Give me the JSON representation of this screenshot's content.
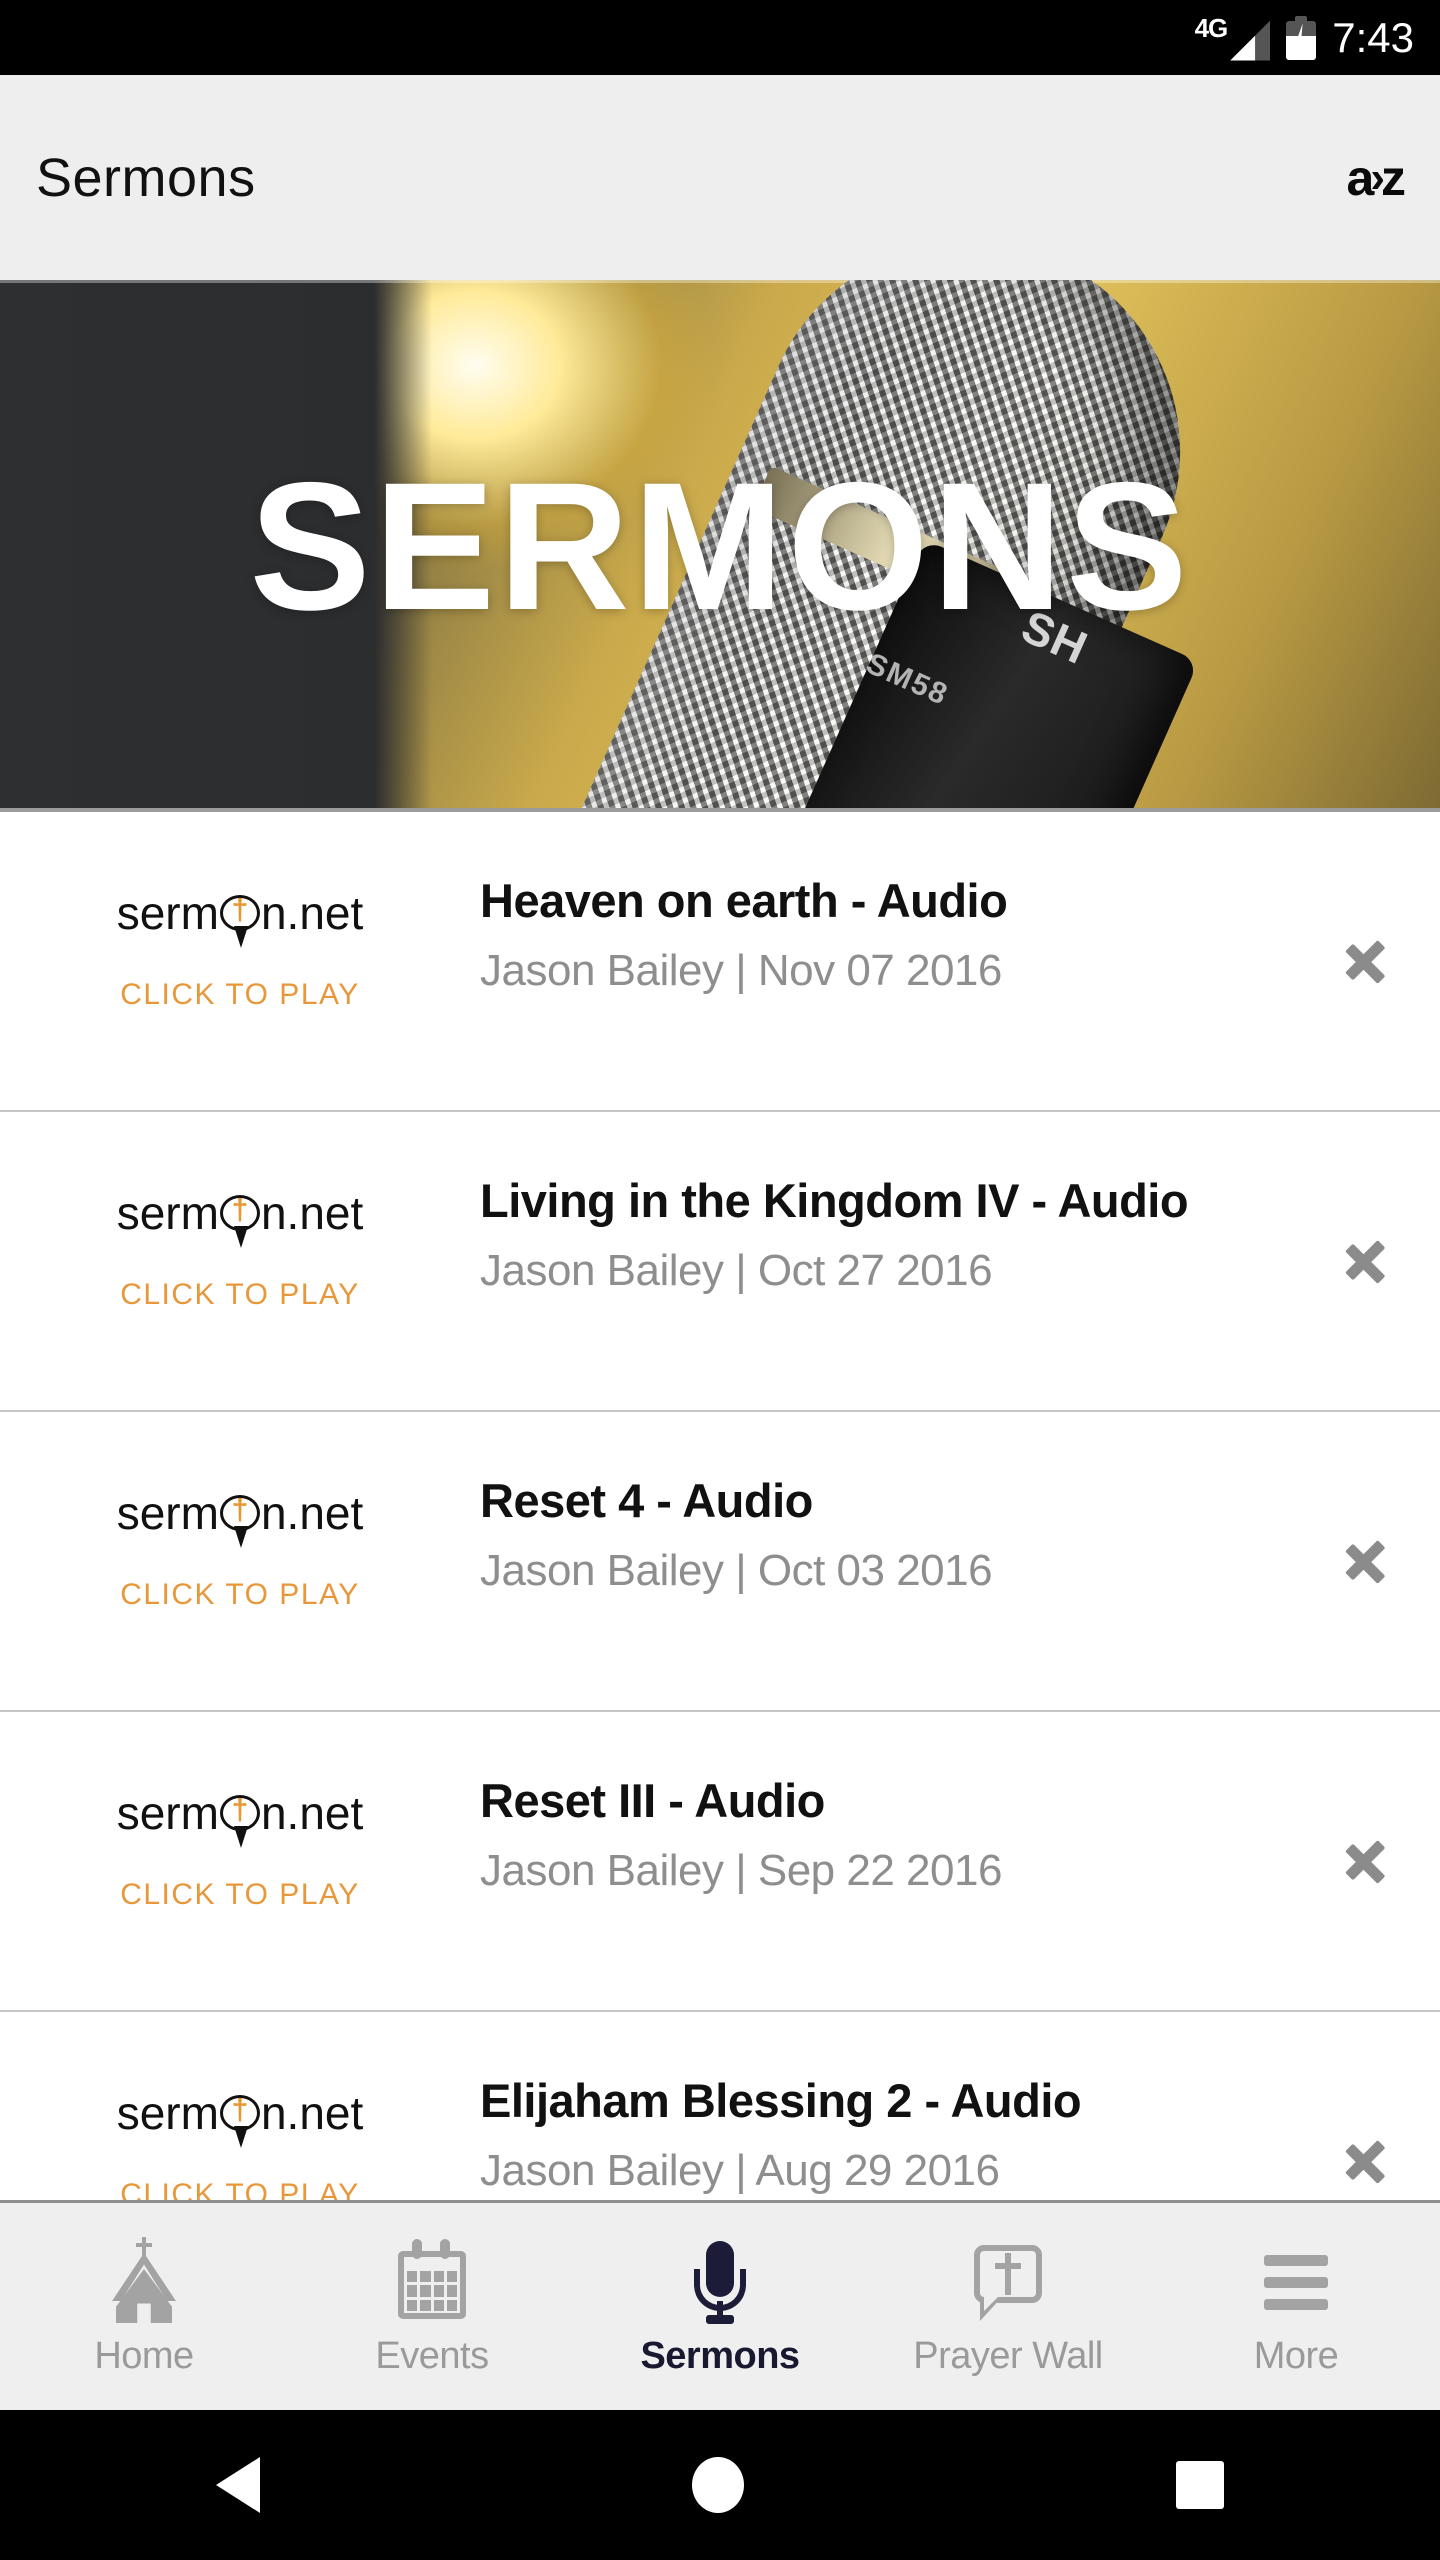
{
  "status_bar": {
    "network": "4G",
    "time": "7:43",
    "battery_icon": "battery-charging-icon",
    "signal_icon": "signal-bars-icon"
  },
  "app_bar": {
    "title": "Sermons",
    "sort_icon_a": "a",
    "sort_icon_chevron": "›",
    "sort_icon_z": "z",
    "sort_icon_name": "a-to-z-sort-icon"
  },
  "hero": {
    "title": "SERMONS",
    "mic_model": "SM58",
    "mic_brand": "SH"
  },
  "list": {
    "logo_text_before": "serm",
    "logo_text_after": "n.net",
    "logo_cross": "†",
    "play_label": "CLICK TO PLAY",
    "chevron_icon": "chevron-right-icon",
    "items": [
      {
        "title": "Heaven on earth - Audio",
        "meta": "Jason Bailey | Nov 07 2016"
      },
      {
        "title": "Living in the Kingdom IV - Audio",
        "meta": "Jason Bailey | Oct 27 2016"
      },
      {
        "title": "Reset 4 - Audio",
        "meta": "Jason Bailey | Oct 03 2016"
      },
      {
        "title": "Reset III - Audio",
        "meta": "Jason Bailey | Sep 22 2016"
      },
      {
        "title": "Elijaham Blessing 2 - Audio",
        "meta": "Jason Bailey | Aug 29 2016"
      }
    ]
  },
  "tab_bar": {
    "tabs": [
      {
        "label": "Home",
        "icon": "church-icon",
        "active": false
      },
      {
        "label": "Events",
        "icon": "calendar-icon",
        "active": false
      },
      {
        "label": "Sermons",
        "icon": "microphone-icon",
        "active": true
      },
      {
        "label": "Prayer Wall",
        "icon": "speech-cross-icon",
        "active": false
      },
      {
        "label": "More",
        "icon": "hamburger-icon",
        "active": false
      }
    ]
  },
  "nav_bar": {
    "back_icon": "back-triangle-icon",
    "home_icon": "home-circle-icon",
    "recents_icon": "recents-square-icon"
  },
  "colors": {
    "accent_orange": "#E8973A",
    "header_bg": "#EEEEEE",
    "tab_active": "#181830",
    "tab_inactive": "#9A9A9A",
    "meta_gray": "#8E8E8E"
  }
}
